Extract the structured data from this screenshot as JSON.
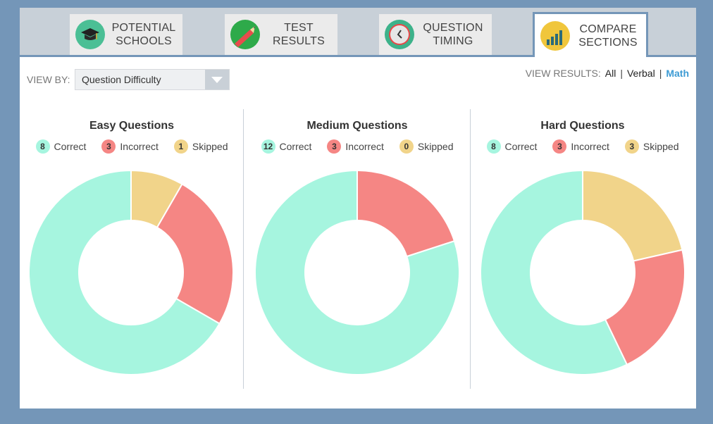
{
  "tabs": [
    {
      "label_line1": "POTENTIAL",
      "label_line2": "SCHOOLS",
      "icon": "graduation-cap-icon",
      "active": false
    },
    {
      "label_line1": "TEST",
      "label_line2": "RESULTS",
      "icon": "pencil-icon",
      "active": false
    },
    {
      "label_line1": "QUESTION",
      "label_line2": "TIMING",
      "icon": "clock-icon",
      "active": false
    },
    {
      "label_line1": "COMPARE",
      "label_line2": "SECTIONS",
      "icon": "bar-chart-icon",
      "active": true
    }
  ],
  "view_by": {
    "label": "VIEW BY:",
    "selected": "Question Difficulty"
  },
  "view_results": {
    "label": "VIEW RESULTS:",
    "options": [
      "All",
      "Verbal",
      "Math"
    ],
    "selected": "Math",
    "separator": "|"
  },
  "colors": {
    "correct": "#a6f5df",
    "incorrect": "#f58684",
    "skipped": "#f1d48a",
    "accent": "#3d9bd4",
    "frame": "#7496b8"
  },
  "chart_data": [
    {
      "type": "pie",
      "title": "Easy Questions",
      "categories": [
        "Correct",
        "Incorrect",
        "Skipped"
      ],
      "values": [
        8,
        3,
        1
      ]
    },
    {
      "type": "pie",
      "title": "Medium Questions",
      "categories": [
        "Correct",
        "Incorrect",
        "Skipped"
      ],
      "values": [
        12,
        3,
        0
      ]
    },
    {
      "type": "pie",
      "title": "Hard Questions",
      "categories": [
        "Correct",
        "Incorrect",
        "Skipped"
      ],
      "values": [
        8,
        3,
        3
      ]
    }
  ]
}
